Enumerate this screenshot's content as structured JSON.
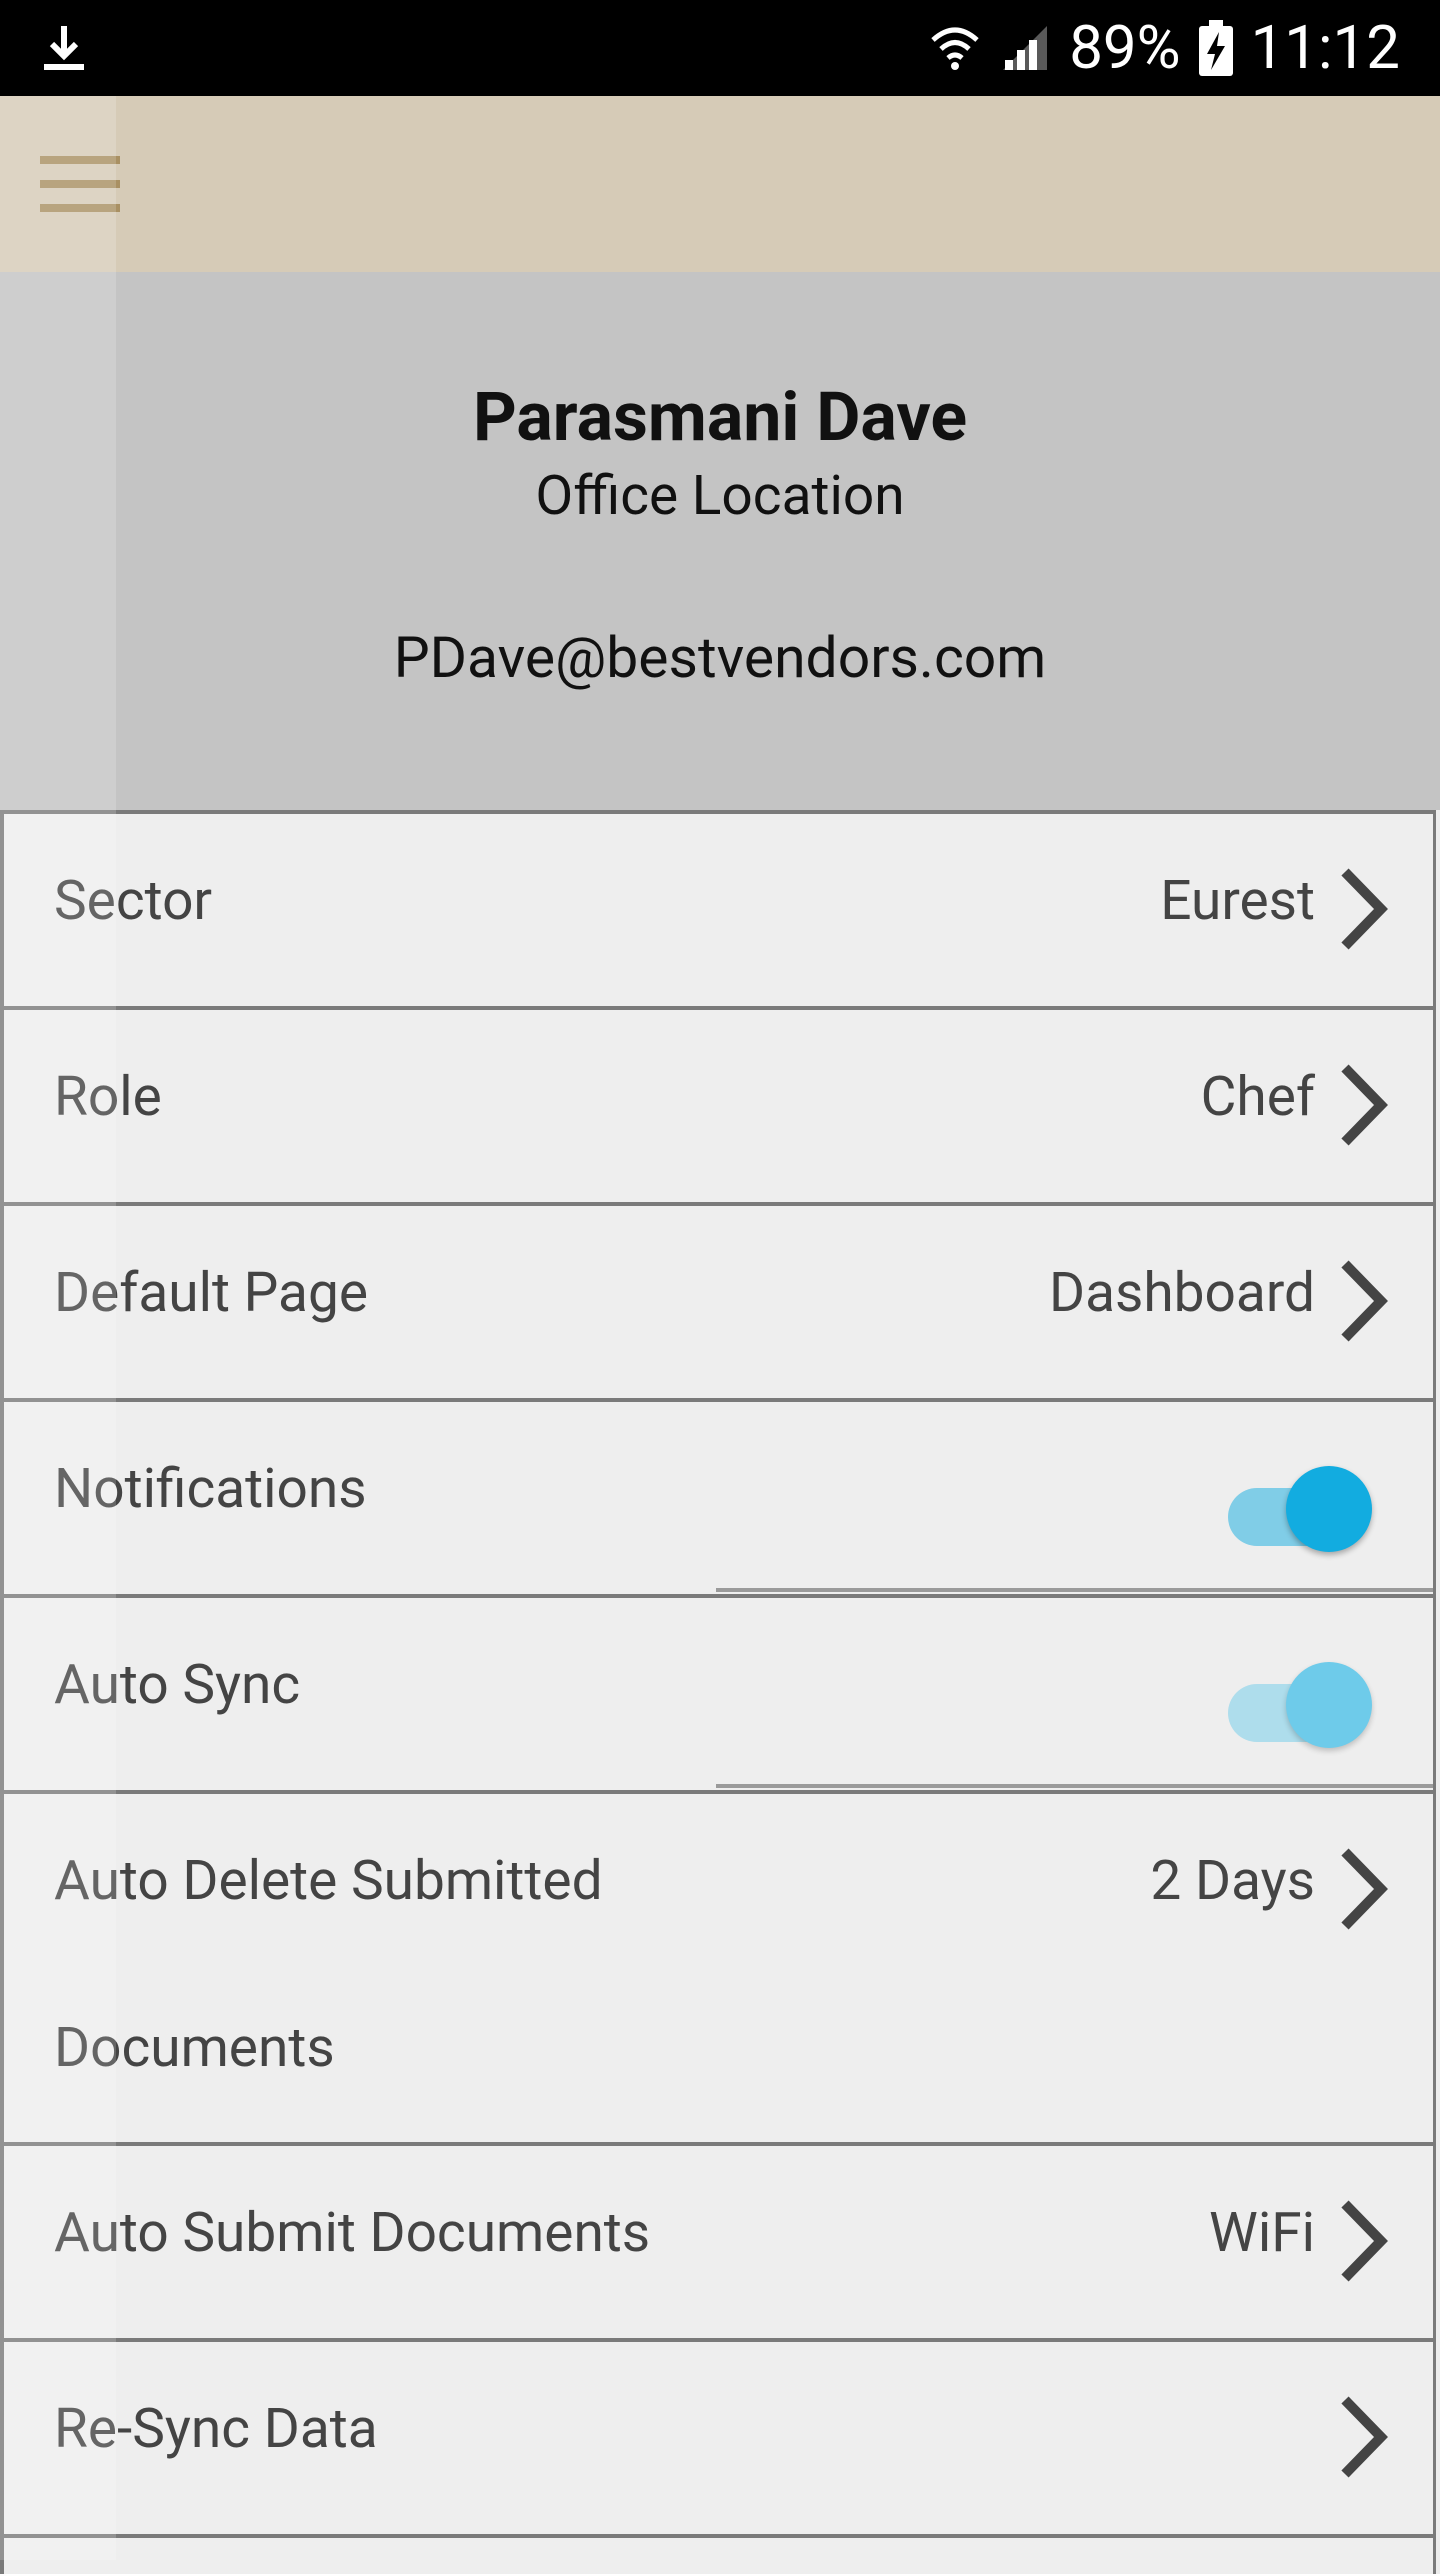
{
  "status_bar": {
    "battery_percent": "89%",
    "time": "11:12",
    "icons": [
      "download-icon",
      "wifi-icon",
      "signal-icon",
      "battery-charging-icon"
    ]
  },
  "app_bar": {
    "menu_icon": "hamburger-menu-icon"
  },
  "profile": {
    "name": "Parasmani Dave",
    "location": "Office Location",
    "email": "PDave@bestvendors.com"
  },
  "settings": {
    "sector": {
      "label": "Sector",
      "value": "Eurest"
    },
    "role": {
      "label": "Role",
      "value": "Chef"
    },
    "default_page": {
      "label": "Default Page",
      "value": "Dashboard"
    },
    "notifications": {
      "label": "Notifications",
      "enabled": true
    },
    "auto_sync": {
      "label": "Auto Sync",
      "enabled": true
    },
    "auto_delete": {
      "label_line1": "Auto Delete Submitted",
      "label_line2": "Documents",
      "value": "2 Days"
    },
    "auto_submit": {
      "label": "Auto Submit Documents",
      "value": "WiFi"
    },
    "resync": {
      "label": "Re-Sync Data"
    }
  },
  "colors": {
    "app_bar": "#d6cbb7",
    "menu_icon": "#a99063",
    "profile_bg": "#c4c4c4",
    "toggle_active": "#12ace0",
    "toggle_active_light": "#6ecbea"
  }
}
